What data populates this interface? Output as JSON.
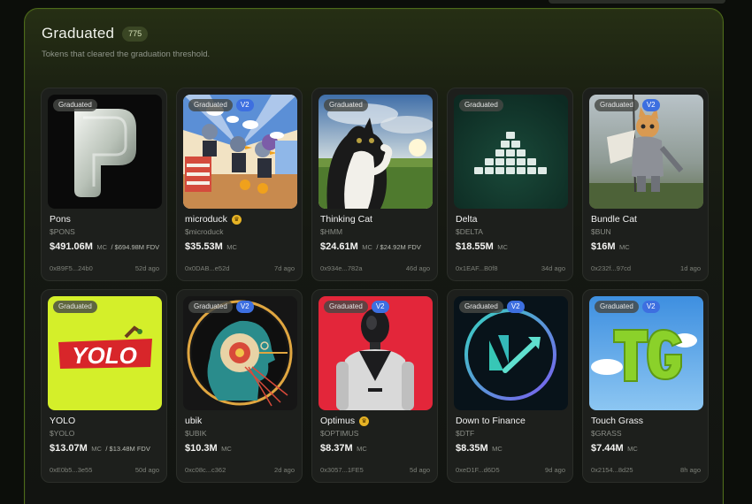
{
  "section": {
    "title": "Graduated",
    "count": "775",
    "subtitle": "Tokens that cleared the graduation threshold."
  },
  "labels": {
    "graduated": "Graduated",
    "v2": "V2",
    "mc": "MC"
  },
  "tokens": [
    {
      "name": "Pons",
      "ticker": "$PONS",
      "mc": "$491.06M",
      "fdv": "/ $694.98M FDV",
      "address": "0xB9F5...24b0",
      "age": "52d ago",
      "v2": false,
      "crown": false,
      "thumb": "pons-logo"
    },
    {
      "name": "microduck",
      "ticker": "$microduck",
      "mc": "$35.53M",
      "fdv": "",
      "address": "0x0DAB...e52d",
      "age": "7d ago",
      "v2": true,
      "crown": true,
      "thumb": "comic-birds"
    },
    {
      "name": "Thinking Cat",
      "ticker": "$HMM",
      "mc": "$24.61M",
      "fdv": "/ $24.92M FDV",
      "address": "0x934e...782a",
      "age": "46d ago",
      "v2": false,
      "crown": false,
      "thumb": "thinking-cat-photo"
    },
    {
      "name": "Delta",
      "ticker": "$DELTA",
      "mc": "$18.55M",
      "fdv": "",
      "address": "0x1EAF...B0f8",
      "age": "34d ago",
      "v2": false,
      "crown": false,
      "thumb": "delta-pyramid"
    },
    {
      "name": "Bundle Cat",
      "ticker": "$BUN",
      "mc": "$16M",
      "fdv": "",
      "address": "0x232f...97cd",
      "age": "1d ago",
      "v2": true,
      "crown": false,
      "thumb": "knight-cat"
    },
    {
      "name": "YOLO",
      "ticker": "$YOLO",
      "mc": "$13.07M",
      "fdv": "/ $13.48M FDV",
      "address": "0xE0b5...3e55",
      "age": "50d ago",
      "v2": false,
      "crown": false,
      "thumb": "yolo-logo"
    },
    {
      "name": "ubik",
      "ticker": "$UBIK",
      "mc": "$10.3M",
      "fdv": "",
      "address": "0xc08c...c362",
      "age": "2d ago",
      "v2": true,
      "crown": false,
      "thumb": "ubik-head"
    },
    {
      "name": "Optimus",
      "ticker": "$OPTIMUS",
      "mc": "$8.37M",
      "fdv": "",
      "address": "0x3057...1FE5",
      "age": "5d ago",
      "v2": true,
      "crown": true,
      "thumb": "optimus-robot"
    },
    {
      "name": "Down to Finance",
      "ticker": "$DTF",
      "mc": "$8.35M",
      "fdv": "",
      "address": "0xeD1F...d6D5",
      "age": "9d ago",
      "v2": true,
      "crown": false,
      "thumb": "dtf-logo"
    },
    {
      "name": "Touch Grass",
      "ticker": "$GRASS",
      "mc": "$7.44M",
      "fdv": "",
      "address": "0x2154...8d25",
      "age": "8h ago",
      "v2": true,
      "crown": false,
      "thumb": "tg-logo"
    }
  ],
  "colors": {
    "accent_border": "#4d6a1a",
    "v2_badge": "#3d6fe0",
    "crown": "#e6b325"
  }
}
